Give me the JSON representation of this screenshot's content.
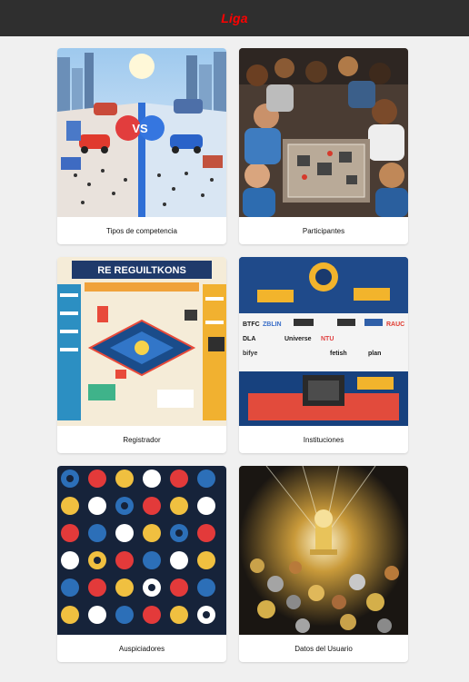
{
  "header": {
    "title": "Liga",
    "title_color": "#ff0000",
    "background": "#2f2f2f"
  },
  "cards": [
    {
      "label": "Tipos de competencia",
      "image": "competition-types-image"
    },
    {
      "label": "Participantes",
      "image": "participants-image"
    },
    {
      "label": "Registrador",
      "image": "registrar-image"
    },
    {
      "label": "Instituciones",
      "image": "institutions-image"
    },
    {
      "label": "Auspiciadores",
      "image": "sponsors-image"
    },
    {
      "label": "Datos del Usuario",
      "image": "user-data-image"
    }
  ]
}
